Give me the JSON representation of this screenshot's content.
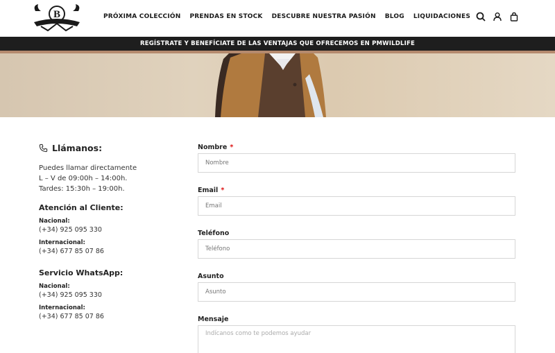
{
  "nav": {
    "items": [
      "PRÓXIMA COLECCIÓN",
      "PRENDAS EN STOCK",
      "DESCUBRE NUESTRA PASIÓN",
      "BLOG",
      "LIQUIDACIONES"
    ]
  },
  "header_icons": [
    "search-icon",
    "user-icon",
    "cart-icon"
  ],
  "promo": {
    "text": "REGÍSTRATE Y BENEFÍCIATE DE LAS VENTAJAS QUE OFRECEMOS EN PMWILDLIFE"
  },
  "contact": {
    "call_title": "Llámanos:",
    "call_lines": [
      "Puedes llamar directamente",
      "L – V de 09:00h – 14:00h.",
      "Tardes: 15:30h – 19:00h."
    ],
    "atencion": {
      "title": "Atención al Cliente:",
      "nacional_label": "Nacional:",
      "nacional": "(+34) 925 095 330",
      "internacional_label": "Internacional:",
      "internacional": "(+34) 677 85 07 86"
    },
    "whatsapp": {
      "title": "Servicio WhatsApp:",
      "nacional_label": "Nacional:",
      "nacional": "(+34) 925 095 330",
      "internacional_label": "Internacional:",
      "internacional": "(+34) 677 85 07 86"
    }
  },
  "form": {
    "nombre": {
      "label": "Nombre",
      "required": "*",
      "placeholder": "Nombre"
    },
    "email": {
      "label": "Email",
      "required": "*",
      "placeholder": "Email"
    },
    "telefono": {
      "label": "Teléfono",
      "placeholder": "Teléfono"
    },
    "asunto": {
      "label": "Asunto",
      "placeholder": "Asunto"
    },
    "mensaje": {
      "label": "Mensaje",
      "placeholder": "Indícanos como te podemos ayudar"
    }
  },
  "colors": {
    "promo_bg": "#1e1e1e",
    "stripe": "#b58a6e",
    "required": "#dd1111"
  }
}
